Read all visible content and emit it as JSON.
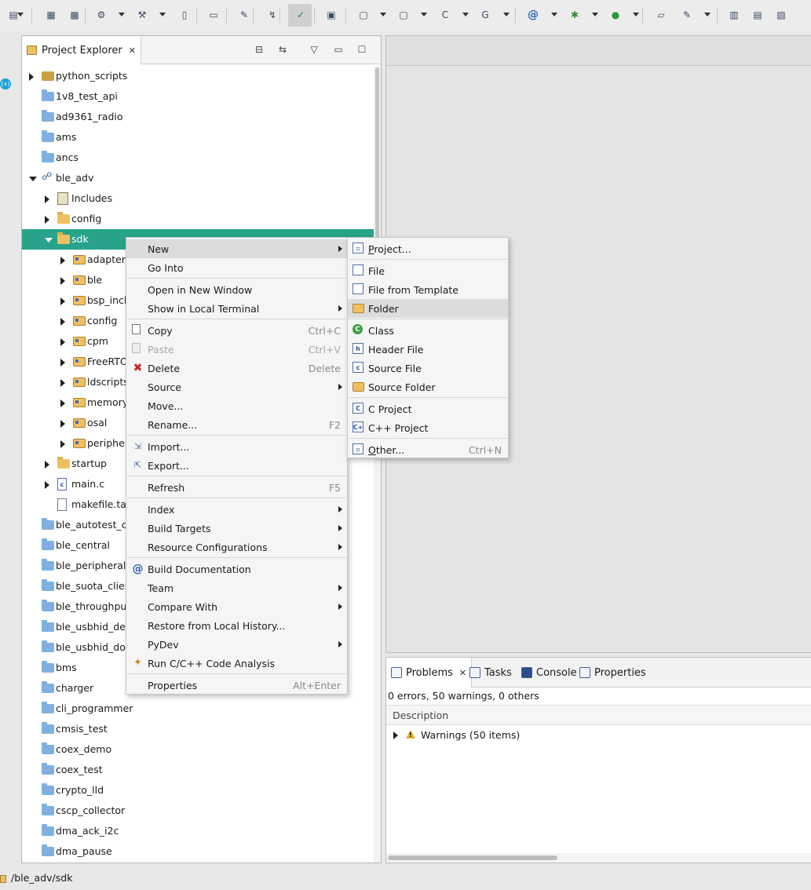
{
  "toolbar": {
    "items": [
      "new-wizard-icon",
      "save-icon",
      "save-all-icon",
      "build-settings-icon",
      "hammer-build-icon",
      "binary-icon",
      "terminal-icon",
      "pin-icon",
      "debug-step-icon",
      "perspective-icon",
      "ide-icon",
      "new-project-icon",
      "new-folder-icon",
      "new-source-icon",
      "new-class-icon",
      "at-icon",
      "bug-icon",
      "run-icon",
      "open-folder-icon",
      "search-icon",
      "layout-icon",
      "list-icon",
      "split-icon"
    ]
  },
  "explorer": {
    "tab_label": "Project Explorer",
    "tree": [
      {
        "label": "python_scripts",
        "icon": "python-project",
        "level": 0,
        "twisty": "closed"
      },
      {
        "label": "1v8_test_api",
        "icon": "project",
        "level": 0,
        "twisty": "none"
      },
      {
        "label": "ad9361_radio",
        "icon": "project",
        "level": 0,
        "twisty": "none"
      },
      {
        "label": "ams",
        "icon": "project",
        "level": 0,
        "twisty": "none"
      },
      {
        "label": "ancs",
        "icon": "project",
        "level": 0,
        "twisty": "none"
      },
      {
        "label": "ble_adv",
        "icon": "c-project",
        "level": 0,
        "twisty": "open"
      },
      {
        "label": "Includes",
        "icon": "includes",
        "level": 1,
        "twisty": "closed"
      },
      {
        "label": "config",
        "icon": "folder",
        "level": 1,
        "twisty": "closed"
      },
      {
        "label": "sdk",
        "icon": "folder",
        "level": 1,
        "twisty": "open",
        "selected": true
      },
      {
        "label": "adapters",
        "icon": "package-folder",
        "level": 2,
        "twisty": "closed"
      },
      {
        "label": "ble",
        "icon": "package-folder",
        "level": 2,
        "twisty": "closed"
      },
      {
        "label": "bsp_inclu",
        "icon": "package-folder",
        "level": 2,
        "twisty": "closed"
      },
      {
        "label": "config",
        "icon": "package-folder",
        "level": 2,
        "twisty": "closed"
      },
      {
        "label": "cpm",
        "icon": "package-folder",
        "level": 2,
        "twisty": "closed"
      },
      {
        "label": "FreeRTO",
        "icon": "package-folder",
        "level": 2,
        "twisty": "closed"
      },
      {
        "label": "ldscripts",
        "icon": "package-folder",
        "level": 2,
        "twisty": "closed"
      },
      {
        "label": "memory",
        "icon": "package-folder",
        "level": 2,
        "twisty": "closed"
      },
      {
        "label": "osal",
        "icon": "package-folder",
        "level": 2,
        "twisty": "closed"
      },
      {
        "label": "periphera",
        "icon": "package-folder",
        "level": 2,
        "twisty": "closed"
      },
      {
        "label": "startup",
        "icon": "folder",
        "level": 1,
        "twisty": "closed"
      },
      {
        "label": "main.c",
        "icon": "c-file",
        "level": 1,
        "twisty": "closed"
      },
      {
        "label": "makefile.targ",
        "icon": "file",
        "level": 1,
        "twisty": "none"
      },
      {
        "label": "ble_autotest_cli",
        "icon": "project",
        "level": 0,
        "twisty": "none"
      },
      {
        "label": "ble_central",
        "icon": "project",
        "level": 0,
        "twisty": "none"
      },
      {
        "label": "ble_peripheral",
        "icon": "project",
        "level": 0,
        "twisty": "none"
      },
      {
        "label": "ble_suota_client",
        "icon": "project",
        "level": 0,
        "twisty": "none"
      },
      {
        "label": "ble_throughput_",
        "icon": "project",
        "level": 0,
        "twisty": "none"
      },
      {
        "label": "ble_usbhid_devi",
        "icon": "project",
        "level": 0,
        "twisty": "none"
      },
      {
        "label": "ble_usbhid_dong",
        "icon": "project",
        "level": 0,
        "twisty": "none"
      },
      {
        "label": "bms",
        "icon": "project",
        "level": 0,
        "twisty": "none"
      },
      {
        "label": "charger",
        "icon": "project",
        "level": 0,
        "twisty": "none"
      },
      {
        "label": "cli_programmer",
        "icon": "project",
        "level": 0,
        "twisty": "none"
      },
      {
        "label": "cmsis_test",
        "icon": "project",
        "level": 0,
        "twisty": "none"
      },
      {
        "label": "coex_demo",
        "icon": "project",
        "level": 0,
        "twisty": "none"
      },
      {
        "label": "coex_test",
        "icon": "project",
        "level": 0,
        "twisty": "none"
      },
      {
        "label": "crypto_lld",
        "icon": "project",
        "level": 0,
        "twisty": "none"
      },
      {
        "label": "cscp_collector",
        "icon": "project",
        "level": 0,
        "twisty": "none"
      },
      {
        "label": "dma_ack_i2c",
        "icon": "project",
        "level": 0,
        "twisty": "none"
      },
      {
        "label": "dma_pause",
        "icon": "project",
        "level": 0,
        "twisty": "none"
      }
    ]
  },
  "context_menu": {
    "items": [
      {
        "label": "New",
        "submenu": true,
        "highlighted": true
      },
      {
        "label": "Go Into"
      },
      {
        "sep": true
      },
      {
        "label": "Open in New Window"
      },
      {
        "label": "Show in Local Terminal",
        "submenu": true
      },
      {
        "sep": true
      },
      {
        "label": "Copy",
        "accel": "Ctrl+C",
        "icon": "copy"
      },
      {
        "label": "Paste",
        "accel": "Ctrl+V",
        "icon": "paste",
        "disabled": true
      },
      {
        "label": "Delete",
        "accel": "Delete",
        "icon": "delete"
      },
      {
        "label": "Source",
        "submenu": true
      },
      {
        "label": "Move..."
      },
      {
        "label": "Rename...",
        "accel": "F2"
      },
      {
        "sep": true
      },
      {
        "label": "Import...",
        "icon": "import"
      },
      {
        "label": "Export...",
        "icon": "export"
      },
      {
        "sep": true
      },
      {
        "label": "Refresh",
        "accel": "F5"
      },
      {
        "sep": true
      },
      {
        "label": "Index",
        "submenu": true
      },
      {
        "label": "Build Targets",
        "submenu": true
      },
      {
        "label": "Resource Configurations",
        "submenu": true
      },
      {
        "sep": true
      },
      {
        "label": "Build Documentation",
        "icon": "at"
      },
      {
        "label": "Team",
        "submenu": true
      },
      {
        "label": "Compare With",
        "submenu": true
      },
      {
        "label": "Restore from Local History..."
      },
      {
        "label": "PyDev",
        "submenu": true
      },
      {
        "label": "Run C/C++ Code Analysis",
        "icon": "wand"
      },
      {
        "sep": true
      },
      {
        "label": "Properties",
        "accel": "Alt+Enter"
      }
    ]
  },
  "new_submenu": {
    "items": [
      {
        "label": "Project...",
        "icon": "new-project",
        "underline": "P"
      },
      {
        "sep": true
      },
      {
        "label": "File",
        "icon": "file"
      },
      {
        "label": "File from Template",
        "icon": "file-template"
      },
      {
        "label": "Folder",
        "icon": "folder",
        "highlighted": true
      },
      {
        "sep": true
      },
      {
        "label": "Class",
        "icon": "class"
      },
      {
        "label": "Header File",
        "icon": "header-file"
      },
      {
        "label": "Source File",
        "icon": "source-file"
      },
      {
        "label": "Source Folder",
        "icon": "source-folder"
      },
      {
        "sep": true
      },
      {
        "label": "C Project",
        "icon": "c-project"
      },
      {
        "label": "C++ Project",
        "icon": "cpp-project"
      },
      {
        "sep": true
      },
      {
        "label": "Other...",
        "accel": "Ctrl+N",
        "icon": "other",
        "underline": "O"
      }
    ]
  },
  "bottom_panel": {
    "tabs": [
      {
        "label": "Problems",
        "active": true
      },
      {
        "label": "Tasks"
      },
      {
        "label": "Console"
      },
      {
        "label": "Properties"
      }
    ],
    "summary": "0 errors, 50 warnings, 0 others",
    "column_header": "Description",
    "rows": [
      {
        "label": "Warnings (50 items)"
      }
    ]
  },
  "status_bar": {
    "path": "/ble_adv/sdk"
  }
}
